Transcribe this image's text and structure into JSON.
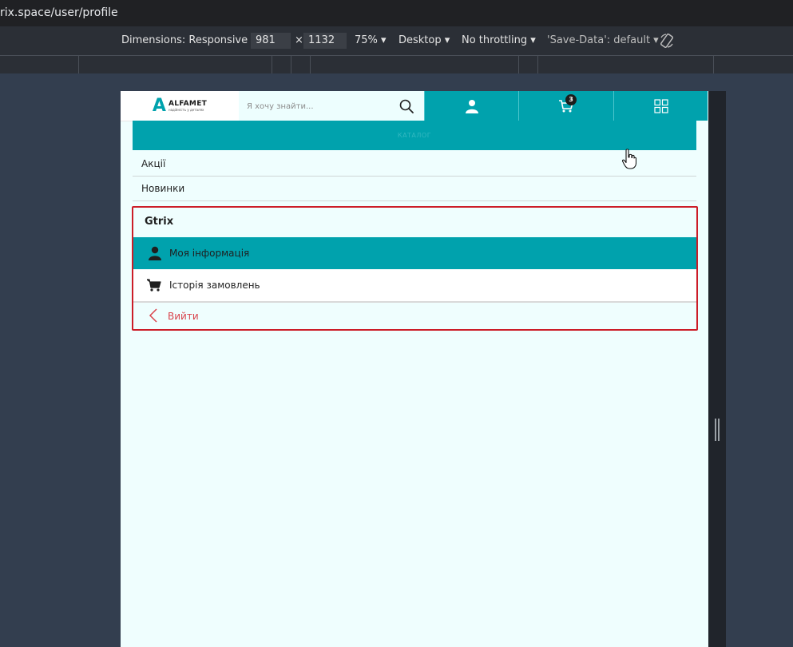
{
  "browser": {
    "url": "rix.space/user/profile"
  },
  "devtools": {
    "dimensions_label": "Dimensions: Responsive ▾",
    "width": "981",
    "times": "×",
    "height": "1132",
    "zoom": "75% ▾",
    "device": "Desktop ▾",
    "throttling": "No throttling ▾",
    "save_data": "'Save-Data': default ▾",
    "rotate_icon": "rotate-icon"
  },
  "site": {
    "logo": {
      "mark": "A",
      "name": "ALFAMET",
      "tagline": "надійність у деталях"
    },
    "search": {
      "placeholder": "Я хочу знайти..."
    },
    "cart_count": "3",
    "catalog_label": "КАТАЛОГ",
    "menu": [
      {
        "label": "Акції"
      },
      {
        "label": "Новинки"
      }
    ]
  },
  "profile": {
    "username": "Gtrix",
    "items": [
      {
        "label": "Моя інформація",
        "icon": "user-icon",
        "active": true
      },
      {
        "label": "Історія замовлень",
        "icon": "cart-icon",
        "active": false
      }
    ],
    "logout_label": "Вийти"
  },
  "colors": {
    "brand": "#00a2ad",
    "page_bg": "#effefe",
    "highlight_border": "#cc1d28",
    "logout": "#d9434c"
  }
}
